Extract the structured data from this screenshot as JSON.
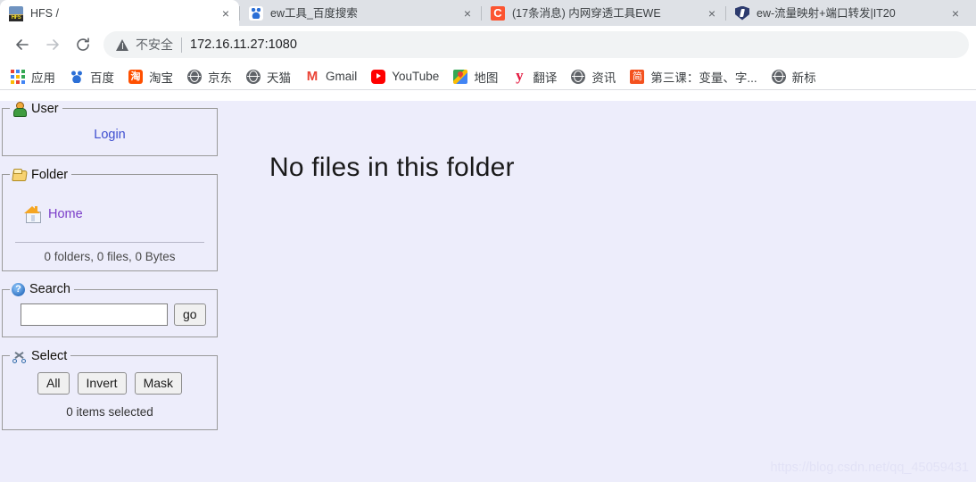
{
  "browser": {
    "tabs": [
      {
        "title": "HFS /",
        "favicon": "hfs-icon",
        "active": true,
        "truncated": false,
        "close_label": "×"
      },
      {
        "title": "ew工具_百度搜索",
        "favicon": "baidu-icon",
        "active": false,
        "truncated": false,
        "close_label": "×"
      },
      {
        "title": "(17条消息) 内网穿透工具EWE",
        "favicon": "csdn-icon",
        "active": false,
        "truncated": true,
        "close_label": "×"
      },
      {
        "title": "ew-流量映射+端口转发|IT20",
        "favicon": "shield-icon",
        "active": false,
        "truncated": true,
        "close_label": "×"
      }
    ],
    "toolbar": {
      "back_label": "←",
      "forward_label": "→",
      "reload_label": "⟳",
      "security_label": "不安全",
      "url_host": "172.16.11.27",
      "url_port": ":1080"
    },
    "bookmarks": [
      {
        "label": "应用",
        "icon": "apps-grid-icon"
      },
      {
        "label": "百度",
        "icon": "baidu-icon"
      },
      {
        "label": "淘宝",
        "icon": "taobao-icon",
        "glyph": "淘"
      },
      {
        "label": "京东",
        "icon": "globe-icon"
      },
      {
        "label": "天猫",
        "icon": "globe-icon"
      },
      {
        "label": "Gmail",
        "icon": "gmail-icon"
      },
      {
        "label": "YouTube",
        "icon": "youtube-icon"
      },
      {
        "label": "地图",
        "icon": "maps-icon"
      },
      {
        "label": "翻译",
        "icon": "youdao-icon"
      },
      {
        "label": "资讯",
        "icon": "globe-icon"
      },
      {
        "label": "第三课：变量、字...",
        "icon": "jianshu-icon",
        "glyph": "简"
      },
      {
        "label": "新标",
        "icon": "globe-icon"
      }
    ]
  },
  "hfs": {
    "user_panel": {
      "legend": "User",
      "legend_icon": "user-icon",
      "login_label": "Login"
    },
    "folder_panel": {
      "legend": "Folder",
      "legend_icon": "folder-icon",
      "home_label": "Home",
      "home_icon": "home-icon",
      "stats": "0 folders, 0 files, 0 Bytes"
    },
    "search_panel": {
      "legend": "Search",
      "legend_icon": "help-icon",
      "input_value": "",
      "input_placeholder": "",
      "go_label": "go"
    },
    "select_panel": {
      "legend": "Select",
      "legend_icon": "scissors-icon",
      "all_label": "All",
      "invert_label": "Invert",
      "mask_label": "Mask",
      "count": "0 items selected"
    },
    "main": {
      "empty_message": "No files in this folder"
    },
    "watermark": "https://blog.csdn.net/qq_45059431"
  },
  "colors": {
    "page_bg": "#EDEDFB",
    "link": "#3f4fd0",
    "visited_link": "#7b3ec9",
    "tabstrip_bg": "#DEE1E6"
  }
}
